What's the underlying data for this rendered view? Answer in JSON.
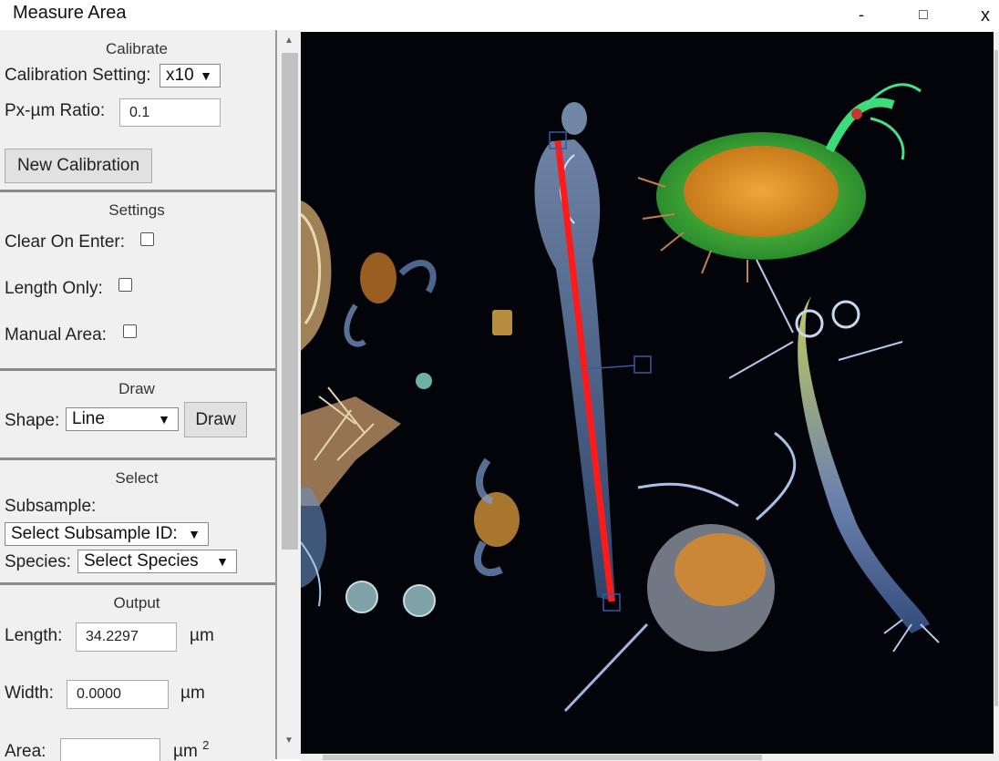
{
  "window": {
    "title": "Measure Area",
    "minimize": "-",
    "maximize": "□",
    "close": "x"
  },
  "calibrate": {
    "title": "Calibrate",
    "setting_label": "Calibration Setting:",
    "setting_value": "x10",
    "ratio_label": "Px-µm Ratio:",
    "ratio_value": "0.1",
    "new_button": "New Calibration"
  },
  "settings": {
    "title": "Settings",
    "clear_on_enter": "Clear On Enter:",
    "length_only": "Length Only:",
    "manual_area": "Manual Area:"
  },
  "draw": {
    "title": "Draw",
    "shape_label": "Shape:",
    "shape_value": "Line",
    "draw_button": "Draw"
  },
  "select": {
    "title": "Select",
    "subsample_label": "Subsample:",
    "subsample_value": "Select Subsample ID:",
    "species_label": "Species:",
    "species_value": "Select Species"
  },
  "output": {
    "title": "Output",
    "length_label": "Length:",
    "length_value": "34.2297",
    "width_label": "Width:",
    "width_value": "0.0000",
    "area_label": "Area:",
    "area_value": "",
    "unit": "µm",
    "area_unit": "µm",
    "area_exp": "2"
  },
  "colors": {
    "measure_line": "#ff1a1a",
    "handle": "#3a5a9a"
  },
  "icons": {
    "dropdown": "▼",
    "scroll_up": "▲",
    "scroll_down": "▼"
  }
}
